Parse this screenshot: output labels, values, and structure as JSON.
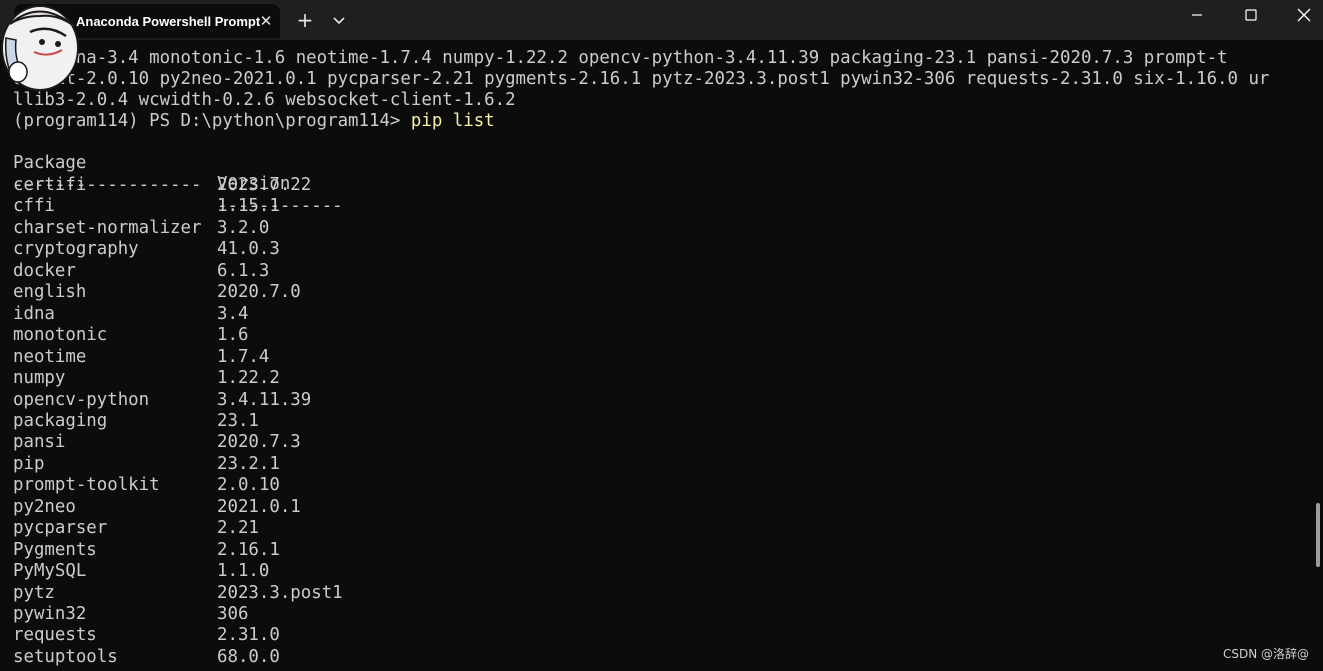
{
  "window": {
    "tab_title": "Anaconda Powershell Prompt",
    "tab_close_glyph": "✕",
    "new_tab_glyph": "+",
    "icons": [
      "avatar-icon",
      "close-icon",
      "plus-icon",
      "chevron-down-icon",
      "minimize-icon",
      "maximize-icon",
      "window-close-icon"
    ]
  },
  "terminal": {
    "output_lines": [
      "    idna-3.4 monotonic-1.6 neotime-1.7.4 numpy-1.22.2 opencv-python-3.4.11.39 packaging-23.1 pansi-2020.7.3 prompt-t",
      "oolkit-2.0.10 py2neo-2021.0.1 pycparser-2.21 pygments-2.16.1 pytz-2023.3.post1 pywin32-306 requests-2.31.0 six-1.16.0 ur",
      "llib3-2.0.4 wcwidth-0.2.6 websocket-client-1.6.2"
    ],
    "prompt": "(program114) PS D:\\python\\program114> ",
    "command": "pip list",
    "header": {
      "package": "Package",
      "version": "Version"
    },
    "separator": {
      "package": "------------------",
      "version": "------------"
    },
    "packages": [
      {
        "name": "certifi",
        "version": "2023.7.22"
      },
      {
        "name": "cffi",
        "version": "1.15.1"
      },
      {
        "name": "charset-normalizer",
        "version": "3.2.0"
      },
      {
        "name": "cryptography",
        "version": "41.0.3"
      },
      {
        "name": "docker",
        "version": "6.1.3"
      },
      {
        "name": "english",
        "version": "2020.7.0"
      },
      {
        "name": "idna",
        "version": "3.4"
      },
      {
        "name": "monotonic",
        "version": "1.6"
      },
      {
        "name": "neotime",
        "version": "1.7.4"
      },
      {
        "name": "numpy",
        "version": "1.22.2"
      },
      {
        "name": "opencv-python",
        "version": "3.4.11.39"
      },
      {
        "name": "packaging",
        "version": "23.1"
      },
      {
        "name": "pansi",
        "version": "2020.7.3"
      },
      {
        "name": "pip",
        "version": "23.2.1"
      },
      {
        "name": "prompt-toolkit",
        "version": "2.0.10"
      },
      {
        "name": "py2neo",
        "version": "2021.0.1"
      },
      {
        "name": "pycparser",
        "version": "2.21"
      },
      {
        "name": "Pygments",
        "version": "2.16.1"
      },
      {
        "name": "PyMySQL",
        "version": "1.1.0"
      },
      {
        "name": "pytz",
        "version": "2023.3.post1"
      },
      {
        "name": "pywin32",
        "version": "306"
      },
      {
        "name": "requests",
        "version": "2.31.0"
      },
      {
        "name": "setuptools",
        "version": "68.0.0"
      }
    ]
  },
  "watermark": "CSDN @洛辞@",
  "colors": {
    "background": "#0c0c0c",
    "titlebar": "#1f1f1f",
    "text": "#cccccc",
    "command": "#f9f1a5"
  }
}
